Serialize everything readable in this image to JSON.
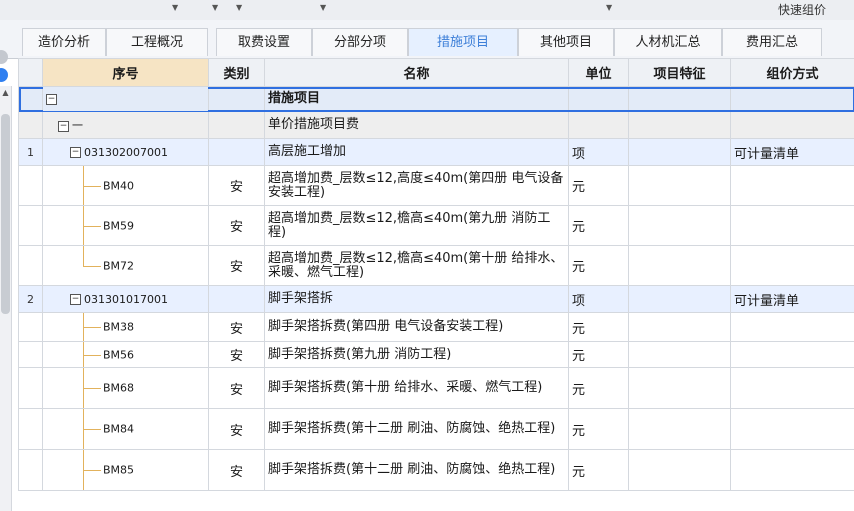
{
  "topbar": {
    "quick_label": "快速组价"
  },
  "tabs": [
    "造价分析",
    "工程概况",
    "取费设置",
    "分部分项",
    "措施项目",
    "其他项目",
    "人材机汇总",
    "费用汇总"
  ],
  "active_tab": "措施项目",
  "columns": [
    "序号",
    "类别",
    "名称",
    "单位",
    "项目特征",
    "组价方式"
  ],
  "rows": {
    "root": {
      "name": "措施项目"
    },
    "group": {
      "seq": "一",
      "name": "单价措施项目费"
    },
    "item1": {
      "idx": "1",
      "code": "031302007001",
      "name": "高层施工增加",
      "unit": "项",
      "method": "可计量清单"
    },
    "sub1": {
      "code": "BM40",
      "type": "安",
      "name": "超高增加费_层数≤12,高度≤40m(第四册 电气设备安装工程)",
      "unit": "元"
    },
    "sub2": {
      "code": "BM59",
      "type": "安",
      "name": "超高增加费_层数≤12,檐高≤40m(第九册 消防工程)",
      "unit": "元"
    },
    "sub3": {
      "code": "BM72",
      "type": "安",
      "name": "超高增加费_层数≤12,檐高≤40m(第十册 给排水、采暖、燃气工程)",
      "unit": "元"
    },
    "item2": {
      "idx": "2",
      "code": "031301017001",
      "name": "脚手架搭拆",
      "unit": "项",
      "method": "可计量清单"
    },
    "sub4": {
      "code": "BM38",
      "type": "安",
      "name": "脚手架搭拆费(第四册 电气设备安装工程)",
      "unit": "元"
    },
    "sub5": {
      "code": "BM56",
      "type": "安",
      "name": "脚手架搭拆费(第九册 消防工程)",
      "unit": "元"
    },
    "sub6": {
      "code": "BM68",
      "type": "安",
      "name": "脚手架搭拆费(第十册 给排水、采暖、燃气工程)",
      "unit": "元"
    },
    "sub7": {
      "code": "BM84",
      "type": "安",
      "name": "脚手架搭拆费(第十二册 刷油、防腐蚀、绝热工程)",
      "unit": "元"
    },
    "sub8": {
      "code": "BM85",
      "type": "安",
      "name": "脚手架搭拆费(第十二册 刷油、防腐蚀、绝热工程)",
      "unit": "元"
    }
  }
}
